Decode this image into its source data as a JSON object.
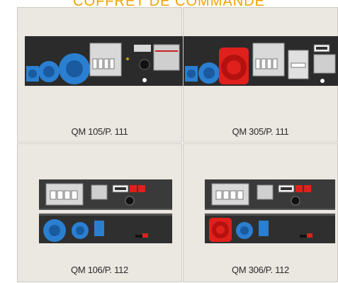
{
  "header": {
    "title": "COFFRET DE COMMANDE"
  },
  "products": [
    {
      "label": "QM 105/P. 111",
      "main_socket_color": "#2a7fd1"
    },
    {
      "label": "QM 305/P. 111",
      "main_socket_color": "#e0201c"
    },
    {
      "label": "QM 106/P. 112",
      "main_socket_color": "#2a7fd1"
    },
    {
      "label": "QM 306/P. 112",
      "main_socket_color": "#e0201c"
    }
  ],
  "colors": {
    "accent": "#f2a300",
    "panel": "#2b2b2b",
    "socket_blue": "#2a7fd1",
    "socket_red": "#e0201c",
    "cell_bg": "#ebe7e1"
  }
}
